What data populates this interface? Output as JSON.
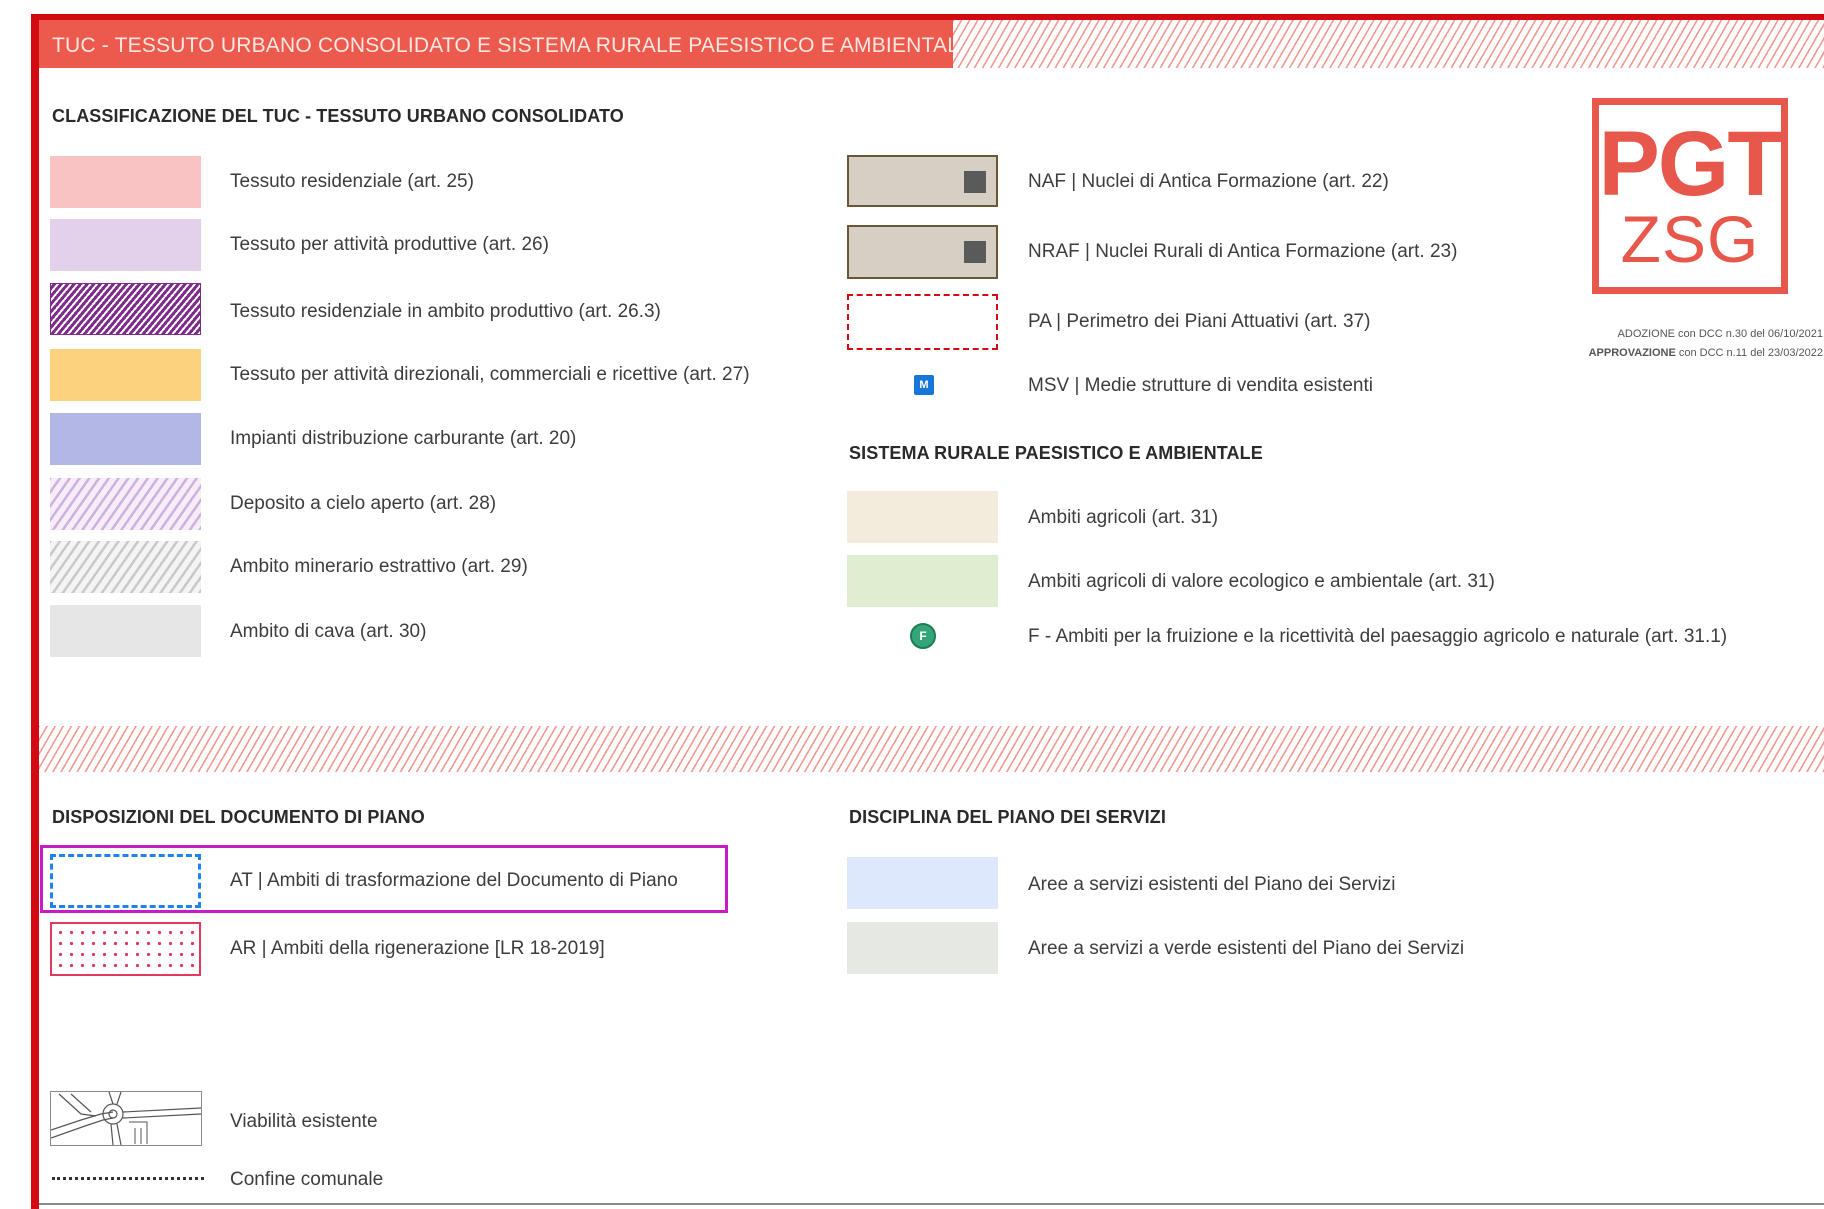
{
  "header": {
    "title": "TUC - TESSUTO URBANO CONSOLIDATO E SISTEMA RURALE PAESISTICO E AMBIENTALE"
  },
  "logo": {
    "line1": "PGT",
    "line2": "ZSG",
    "adozione_label": "ADOZIONE",
    "adozione_text": " con DCC n.30 del 06/10/2021",
    "approvazione_label": "APPROVAZIONE",
    "approvazione_text": " con DCC n.11 del 23/03/2022",
    "color": "#e8574c"
  },
  "tuc": {
    "heading": "CLASSIFICAZIONE DEL TUC - TESSUTO URBANO CONSOLIDATO",
    "items": [
      {
        "label": "Tessuto residenziale (art. 25)",
        "color": "#f9c3c4"
      },
      {
        "label": "Tessuto per attività produttive (art. 26)",
        "color": "#e3d1ec"
      },
      {
        "label": "Tessuto residenziale in ambito produttivo (art. 26.3)",
        "color": "#7d2c8a"
      },
      {
        "label": "Tessuto per attività direzionali, commerciali e ricettive (art. 27)",
        "color": "#fdd27e"
      },
      {
        "label": "Impianti distribuzione carburante (art. 20)",
        "color": "#b2b7e5"
      },
      {
        "label": "Deposito a cielo aperto (art. 28)",
        "color": "#cfb0df"
      },
      {
        "label": "Ambito minerario estrattivo (art. 29)",
        "color": "#c9c9c9"
      },
      {
        "label": "Ambito di cava (art. 30)",
        "color": "#e6e6e6"
      }
    ]
  },
  "nuclei": {
    "items": [
      {
        "label": "NAF | Nuclei di Antica Formazione (art. 22)"
      },
      {
        "label": "NRAF | Nuclei Rurali di Antica Formazione (art. 23)"
      },
      {
        "label": "PA | Perimetro dei Piani Attuativi (art. 37)"
      },
      {
        "label": "MSV | Medie strutture di vendita esistenti",
        "icon_text": "M",
        "icon": "msv-marker-icon"
      }
    ]
  },
  "rurale": {
    "heading": "SISTEMA RURALE PAESISTICO E AMBIENTALE",
    "items": [
      {
        "label": "Ambiti agricoli (art. 31)",
        "color": "#f3ecdd"
      },
      {
        "label": "Ambiti agricoli di valore ecologico e ambientale (art. 31)",
        "color": "#dfeed0"
      },
      {
        "label": "F - Ambiti per la fruizione e la ricettività del paesaggio agricolo e naturale (art. 31.1)",
        "icon_text": "F",
        "icon": "f-marker-icon"
      }
    ]
  },
  "documento_piano": {
    "heading": "DISPOSIZIONI DEL DOCUMENTO DI PIANO",
    "items": [
      {
        "label": "AT | Ambiti di trasformazione del Documento di Piano",
        "highlighted": true
      },
      {
        "label": "AR | Ambiti della rigenerazione [LR 18-2019]"
      }
    ]
  },
  "piano_servizi": {
    "heading": "DISCIPLINA DEL PIANO DEI SERVIZI",
    "items": [
      {
        "label": "Aree a servizi esistenti del Piano dei Servizi",
        "color": "#dde8fd"
      },
      {
        "label": "Aree a servizi a verde esistenti del Piano dei Servizi",
        "color": "#e6e9e3"
      }
    ]
  },
  "other": {
    "items": [
      {
        "label": "Viabilità esistente",
        "icon": "road-map-icon"
      },
      {
        "label": "Confine comunale",
        "icon": "dotted-line-icon"
      }
    ]
  },
  "colors": {
    "frame": "#d40a12",
    "title_bar": "#ec5a4e",
    "highlight_box": "#c51cc4"
  }
}
